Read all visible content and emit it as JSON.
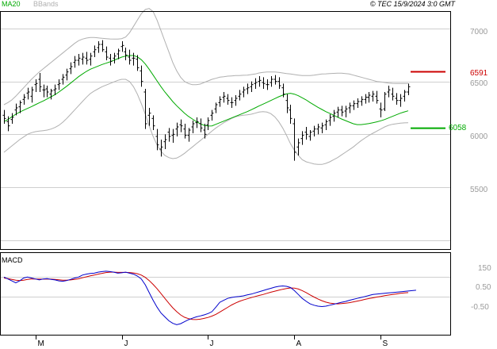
{
  "header": {
    "legend_ma": "MA20",
    "legend_bb": "BBands",
    "copyright": "© TEC 15/9/2024 3:0 GMT"
  },
  "colors": {
    "price": "#000000",
    "ma": "#00aa00",
    "bbands": "#b0b0b0",
    "resistance": "#cc0000",
    "support": "#00aa00",
    "macd": "#0000cc",
    "signal": "#cc0000",
    "grid": "#cfcfcf",
    "axis_text": "#9a9a9a"
  },
  "chart_data": [
    {
      "type": "ohlc",
      "y_ticks": [
        "7000",
        "6500",
        "6000",
        "5500"
      ],
      "y_tick_values": [
        7000,
        6500,
        6000,
        5500
      ],
      "ylim": [
        5000,
        7250
      ],
      "x_labels": [
        "M",
        "J",
        "J",
        "A",
        "S"
      ],
      "x_label_index": [
        8,
        30,
        52,
        74,
        96
      ],
      "grid": true,
      "resistance": {
        "label": "6591",
        "value": 6591
      },
      "support": {
        "label": "6058",
        "value": 6058
      },
      "series": [
        {
          "name": "MA20",
          "values": [
            6120,
            6140,
            6165,
            6190,
            6210,
            6228,
            6245,
            6262,
            6280,
            6298,
            6315,
            6335,
            6355,
            6375,
            6400,
            6428,
            6455,
            6485,
            6515,
            6545,
            6570,
            6595,
            6615,
            6630,
            6645,
            6660,
            6672,
            6685,
            6700,
            6715,
            6730,
            6740,
            6745,
            6745,
            6732,
            6705,
            6665,
            6615,
            6560,
            6505,
            6450,
            6400,
            6355,
            6310,
            6270,
            6235,
            6200,
            6170,
            6145,
            6120,
            6100,
            6085,
            6078,
            6080,
            6095,
            6110,
            6125,
            6140,
            6155,
            6170,
            6185,
            6200,
            6215,
            6232,
            6250,
            6268,
            6285,
            6302,
            6320,
            6338,
            6355,
            6370,
            6382,
            6388,
            6380,
            6365,
            6345,
            6325,
            6300,
            6278,
            6255,
            6235,
            6215,
            6198,
            6180,
            6162,
            6145,
            6130,
            6115,
            6100,
            6092,
            6092,
            6096,
            6102,
            6110,
            6118,
            6128,
            6140,
            6155,
            6170,
            6185,
            6200,
            6212,
            6222
          ]
        },
        {
          "name": "BBands upper",
          "values": [
            6280,
            6300,
            6325,
            6360,
            6400,
            6440,
            6480,
            6520,
            6555,
            6590,
            6620,
            6650,
            6680,
            6710,
            6740,
            6770,
            6800,
            6830,
            6860,
            6885,
            6900,
            6910,
            6915,
            6915,
            6912,
            6908,
            6905,
            6902,
            6900,
            6900,
            6905,
            6920,
            6960,
            7020,
            7080,
            7140,
            7180,
            7190,
            7160,
            7080,
            6980,
            6880,
            6780,
            6680,
            6600,
            6540,
            6500,
            6480,
            6470,
            6470,
            6475,
            6490,
            6505,
            6520,
            6530,
            6540,
            6545,
            6550,
            6552,
            6555,
            6556,
            6558,
            6560,
            6565,
            6570,
            6580,
            6585,
            6590,
            6590,
            6590,
            6585,
            6580,
            6575,
            6570,
            6565,
            6560,
            6555,
            6555,
            6556,
            6560,
            6565,
            6570,
            6572,
            6575,
            6576,
            6578,
            6578,
            6575,
            6570,
            6560,
            6550,
            6540,
            6530,
            6520,
            6510,
            6500,
            6495,
            6490,
            6485,
            6482,
            6480,
            6480,
            6480,
            6480
          ]
        },
        {
          "name": "BBands lower",
          "values": [
            5830,
            5860,
            5890,
            5920,
            5950,
            5975,
            6000,
            6015,
            6025,
            6030,
            6035,
            6040,
            6050,
            6065,
            6085,
            6115,
            6150,
            6190,
            6230,
            6270,
            6310,
            6350,
            6385,
            6410,
            6430,
            6450,
            6465,
            6480,
            6495,
            6510,
            6520,
            6520,
            6500,
            6450,
            6380,
            6290,
            6190,
            6080,
            5980,
            5900,
            5840,
            5800,
            5780,
            5770,
            5775,
            5795,
            5820,
            5850,
            5880,
            5910,
            5940,
            5970,
            6000,
            6030,
            6060,
            6085,
            6110,
            6130,
            6150,
            6165,
            6175,
            6180,
            6185,
            6190,
            6200,
            6210,
            6215,
            6210,
            6195,
            6165,
            6120,
            6060,
            5990,
            5910,
            5850,
            5800,
            5760,
            5740,
            5730,
            5720,
            5715,
            5715,
            5725,
            5740,
            5760,
            5780,
            5805,
            5830,
            5855,
            5880,
            5910,
            5940,
            5965,
            5990,
            6010,
            6030,
            6050,
            6070,
            6085,
            6095,
            6100,
            6105,
            6108,
            6110
          ]
        }
      ],
      "ohlc": [
        [
          6180,
          6230,
          6100,
          6150
        ],
        [
          6120,
          6170,
          6030,
          6080
        ],
        [
          6140,
          6200,
          6100,
          6160
        ],
        [
          6230,
          6290,
          6180,
          6250
        ],
        [
          6260,
          6320,
          6200,
          6300
        ],
        [
          6330,
          6380,
          6280,
          6350
        ],
        [
          6390,
          6440,
          6330,
          6400
        ],
        [
          6360,
          6450,
          6300,
          6420
        ],
        [
          6470,
          6520,
          6400,
          6480
        ],
        [
          6520,
          6580,
          6400,
          6450
        ],
        [
          6420,
          6470,
          6350,
          6420
        ],
        [
          6430,
          6460,
          6350,
          6400
        ],
        [
          6380,
          6430,
          6330,
          6410
        ],
        [
          6420,
          6470,
          6370,
          6430
        ],
        [
          6470,
          6520,
          6420,
          6480
        ],
        [
          6520,
          6570,
          6470,
          6540
        ],
        [
          6560,
          6620,
          6510,
          6590
        ],
        [
          6620,
          6680,
          6570,
          6640
        ],
        [
          6680,
          6740,
          6630,
          6700
        ],
        [
          6700,
          6760,
          6650,
          6720
        ],
        [
          6710,
          6770,
          6660,
          6730
        ],
        [
          6720,
          6780,
          6660,
          6700
        ],
        [
          6710,
          6770,
          6650,
          6740
        ],
        [
          6780,
          6840,
          6730,
          6800
        ],
        [
          6820,
          6880,
          6770,
          6850
        ],
        [
          6850,
          6890,
          6780,
          6800
        ],
        [
          6780,
          6830,
          6700,
          6730
        ],
        [
          6720,
          6760,
          6650,
          6690
        ],
        [
          6720,
          6770,
          6670,
          6740
        ],
        [
          6760,
          6810,
          6710,
          6790
        ],
        [
          6830,
          6880,
          6780,
          6840
        ],
        [
          6780,
          6820,
          6700,
          6750
        ],
        [
          6730,
          6800,
          6660,
          6700
        ],
        [
          6720,
          6770,
          6650,
          6720
        ],
        [
          6710,
          6750,
          6600,
          6630
        ],
        [
          6600,
          6650,
          6450,
          6500
        ],
        [
          6400,
          6430,
          6050,
          6100
        ],
        [
          6180,
          6250,
          6080,
          6200
        ],
        [
          6150,
          6180,
          6040,
          6080
        ],
        [
          5980,
          6050,
          5850,
          5900
        ],
        [
          5860,
          5950,
          5790,
          5880
        ],
        [
          5930,
          6000,
          5860,
          5950
        ],
        [
          6020,
          6060,
          5930,
          5980
        ],
        [
          5990,
          6050,
          5920,
          6000
        ],
        [
          6050,
          6110,
          5980,
          6070
        ],
        [
          6090,
          6140,
          6020,
          6080
        ],
        [
          6050,
          6100,
          5960,
          5990
        ],
        [
          5990,
          6060,
          5930,
          6040
        ],
        [
          6070,
          6130,
          6010,
          6100
        ],
        [
          6110,
          6160,
          6060,
          6120
        ],
        [
          6100,
          6150,
          6020,
          6060
        ],
        [
          6040,
          6100,
          5960,
          6000
        ],
        [
          6090,
          6160,
          6040,
          6130
        ],
        [
          6180,
          6230,
          6130,
          6200
        ],
        [
          6240,
          6300,
          6200,
          6280
        ],
        [
          6300,
          6360,
          6260,
          6330
        ],
        [
          6350,
          6400,
          6300,
          6360
        ],
        [
          6340,
          6380,
          6280,
          6320
        ],
        [
          6300,
          6350,
          6250,
          6300
        ],
        [
          6320,
          6370,
          6270,
          6340
        ],
        [
          6360,
          6420,
          6320,
          6380
        ],
        [
          6400,
          6450,
          6350,
          6420
        ],
        [
          6430,
          6480,
          6380,
          6440
        ],
        [
          6450,
          6500,
          6400,
          6470
        ],
        [
          6480,
          6530,
          6430,
          6490
        ],
        [
          6500,
          6550,
          6450,
          6510
        ],
        [
          6490,
          6540,
          6430,
          6480
        ],
        [
          6470,
          6520,
          6420,
          6470
        ],
        [
          6490,
          6550,
          6450,
          6520
        ],
        [
          6520,
          6560,
          6470,
          6500
        ],
        [
          6500,
          6540,
          6430,
          6460
        ],
        [
          6440,
          6480,
          6350,
          6380
        ],
        [
          6320,
          6380,
          6200,
          6250
        ],
        [
          6230,
          6280,
          6100,
          6150
        ],
        [
          6100,
          6150,
          5750,
          5830
        ],
        [
          5880,
          5960,
          5800,
          5920
        ],
        [
          5960,
          6030,
          5900,
          5990
        ],
        [
          6020,
          6070,
          5950,
          6000
        ],
        [
          5980,
          6040,
          5940,
          6020
        ],
        [
          6030,
          6080,
          5980,
          6050
        ],
        [
          6050,
          6100,
          6000,
          6070
        ],
        [
          6060,
          6110,
          6010,
          6080
        ],
        [
          6090,
          6140,
          6040,
          6120
        ],
        [
          6130,
          6190,
          6080,
          6160
        ],
        [
          6170,
          6230,
          6120,
          6200
        ],
        [
          6210,
          6260,
          6160,
          6230
        ],
        [
          6230,
          6270,
          6170,
          6210
        ],
        [
          6220,
          6270,
          6160,
          6240
        ],
        [
          6250,
          6300,
          6200,
          6270
        ],
        [
          6270,
          6320,
          6230,
          6290
        ],
        [
          6290,
          6340,
          6250,
          6310
        ],
        [
          6310,
          6360,
          6270,
          6330
        ],
        [
          6330,
          6380,
          6290,
          6350
        ],
        [
          6350,
          6400,
          6300,
          6370
        ],
        [
          6360,
          6410,
          6310,
          6380
        ],
        [
          6360,
          6410,
          6290,
          6320
        ],
        [
          6240,
          6300,
          6160,
          6230
        ],
        [
          6240,
          6400,
          6220,
          6380
        ],
        [
          6400,
          6460,
          6350,
          6420
        ],
        [
          6380,
          6440,
          6320,
          6360
        ],
        [
          6340,
          6390,
          6280,
          6320
        ],
        [
          6320,
          6380,
          6260,
          6340
        ],
        [
          6360,
          6420,
          6310,
          6400
        ],
        [
          6400,
          6480,
          6370,
          6450
        ]
      ]
    },
    {
      "type": "line",
      "title": "MACD",
      "y_ticks": [
        "150",
        "0.50",
        "-0.50"
      ],
      "y_tick_values": [
        150,
        50,
        -50
      ],
      "ylim": [
        -150,
        200
      ],
      "grid": true,
      "series": [
        {
          "name": "MACD",
          "values": [
            100,
            90,
            80,
            70,
            80,
            95,
            100,
            95,
            90,
            85,
            90,
            92,
            88,
            85,
            80,
            78,
            82,
            88,
            95,
            100,
            110,
            115,
            118,
            120,
            125,
            128,
            130,
            128,
            125,
            120,
            122,
            125,
            120,
            115,
            105,
            90,
            60,
            20,
            -20,
            -55,
            -85,
            -105,
            -125,
            -138,
            -145,
            -140,
            -130,
            -120,
            -112,
            -105,
            -100,
            -95,
            -88,
            -78,
            -55,
            -30,
            -20,
            -10,
            -5,
            -2,
            0,
            3,
            8,
            12,
            18,
            24,
            30,
            36,
            42,
            48,
            52,
            54,
            52,
            46,
            30,
            10,
            -10,
            -25,
            -38,
            -45,
            -50,
            -52,
            -50,
            -45,
            -40,
            -35,
            -30,
            -26,
            -20,
            -15,
            -10,
            -5,
            0,
            5,
            10,
            12,
            14,
            16,
            18,
            20,
            22,
            24,
            26,
            28,
            30,
            32
          ]
        },
        {
          "name": "Signal",
          "values": [
            95,
            92,
            88,
            84,
            82,
            84,
            88,
            90,
            90,
            89,
            89,
            90,
            89,
            88,
            86,
            84,
            84,
            85,
            88,
            91,
            96,
            101,
            106,
            110,
            115,
            119,
            123,
            125,
            125,
            124,
            124,
            124,
            123,
            121,
            117,
            110,
            98,
            82,
            62,
            40,
            15,
            -10,
            -35,
            -58,
            -78,
            -95,
            -107,
            -114,
            -118,
            -119,
            -117,
            -113,
            -108,
            -101,
            -92,
            -80,
            -68,
            -56,
            -44,
            -34,
            -25,
            -18,
            -12,
            -6,
            0,
            5,
            10,
            16,
            22,
            27,
            32,
            37,
            41,
            44,
            43,
            38,
            30,
            20,
            8,
            -3,
            -13,
            -22,
            -29,
            -34,
            -37,
            -38,
            -37,
            -35,
            -32,
            -28,
            -24,
            -20,
            -15,
            -11,
            -7,
            -3,
            0,
            4,
            7,
            10,
            13,
            16,
            18,
            20
          ]
        }
      ]
    }
  ]
}
